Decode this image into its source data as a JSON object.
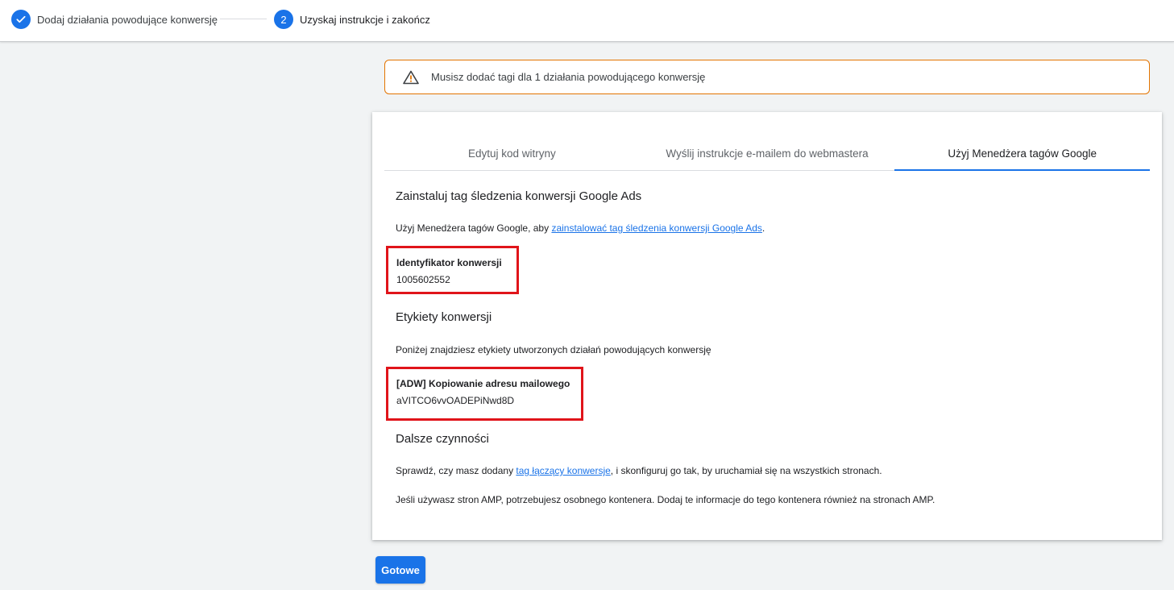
{
  "stepper": {
    "step1": {
      "label": "Dodaj działania powodujące konwersję",
      "state": "completed"
    },
    "step2": {
      "number": "2",
      "label": "Uzyskaj instrukcje i zakończ",
      "state": "active"
    }
  },
  "warning": {
    "icon": "warning-triangle-icon",
    "text": "Musisz dodać tagi dla 1 działania powodującego konwersję"
  },
  "tabs": [
    {
      "label": "Edytuj kod witryny",
      "active": false
    },
    {
      "label": "Wyślij instrukcje e-mailem do webmastera",
      "active": false
    },
    {
      "label": "Użyj Menedżera tagów Google",
      "active": true
    }
  ],
  "install": {
    "heading": "Zainstaluj tag śledzenia konwersji Google Ads",
    "text_before": "Użyj Menedżera tagów Google, aby ",
    "link": "zainstalować tag śledzenia konwersji Google Ads",
    "text_after": "."
  },
  "conversion_id": {
    "label": "Identyfikator konwersji",
    "value": "1005602552"
  },
  "labels_section": {
    "heading": "Etykiety konwersji",
    "text": "Poniżej znajdziesz etykiety utworzonych działań powodujących konwersję"
  },
  "conversion_label": {
    "name": "[ADW] Kopiowanie adresu mailowego",
    "value": "aVITCO6vvOADEPiNwd8D"
  },
  "next_steps": {
    "heading": "Dalsze czynności",
    "p1_before": "Sprawdź, czy masz dodany ",
    "p1_link": "tag łączący konwersje",
    "p1_after": ", i skonfiguruj go tak, by uruchamiał się na wszystkich stronach.",
    "p2": "Jeśli używasz stron AMP, potrzebujesz osobnego kontenera. Dodaj te informacje do tego kontenera również na stronach AMP."
  },
  "done_button": "Gotowe",
  "colors": {
    "accent": "#1a73e8",
    "warning": "#e37400",
    "highlight": "#e0141a"
  }
}
